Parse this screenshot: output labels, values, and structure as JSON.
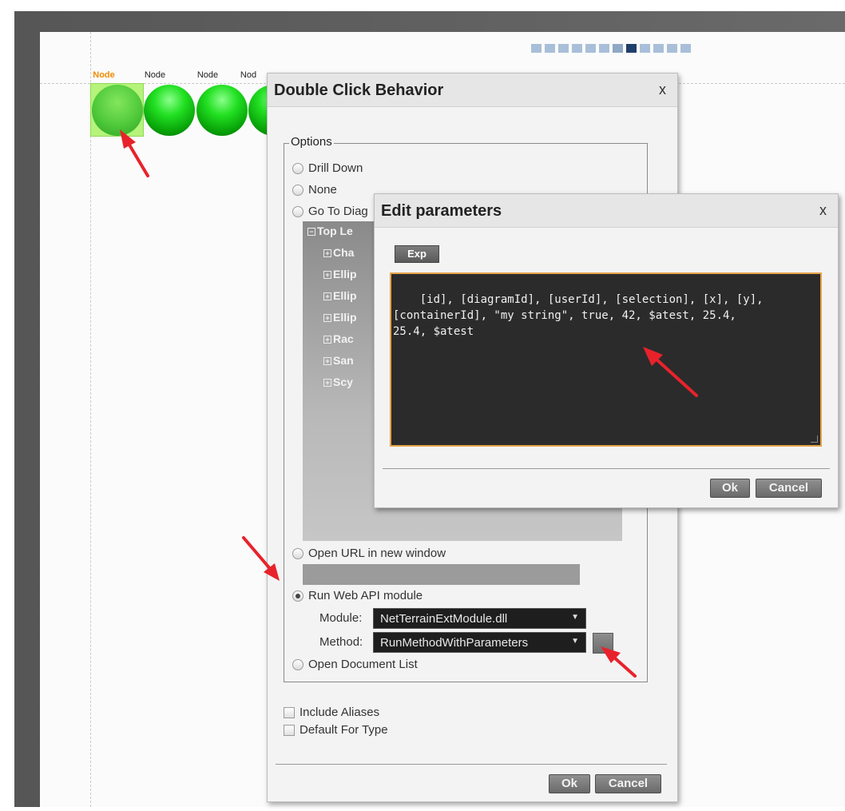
{
  "canvas": {
    "node_labels": [
      "Node",
      "Node",
      "Node",
      "Nod"
    ],
    "pager_count": 12,
    "pager_active_index": 7
  },
  "double_click_dialog": {
    "title": "Double Click Behavior",
    "close": "x",
    "options_legend": "Options",
    "options": {
      "drill_down": "Drill Down",
      "none": "None",
      "go_to_diagram": "Go To Diag",
      "open_url": "Open URL in new window",
      "run_web_api": "Run Web API module",
      "open_document_list": "Open Document List"
    },
    "tree": {
      "root": "Top Le",
      "items": [
        "Cha",
        "Ellip",
        "Ellip",
        "Ellip",
        "Rac",
        "San",
        "Scy"
      ]
    },
    "module_label": "Module:",
    "module_value": "NetTerrainExtModule.dll",
    "method_label": "Method:",
    "method_value": "RunMethodWithParameters",
    "include_aliases": "Include Aliases",
    "default_for_type": "Default For Type",
    "ok": "Ok",
    "cancel": "Cancel"
  },
  "edit_parameters_dialog": {
    "title": "Edit parameters",
    "close": "x",
    "exp_button": "Exp",
    "parameters": "[id], [diagramId], [userId], [selection], [x], [y],\n[containerId], \"my string\", true, 42, $atest, 25.4,\n25.4, $atest",
    "ok": "Ok",
    "cancel": "Cancel"
  },
  "colors": {
    "annotation_arrow": "#e8222b",
    "selected_label": "#f08c00",
    "textarea_border": "#e6a34a"
  }
}
